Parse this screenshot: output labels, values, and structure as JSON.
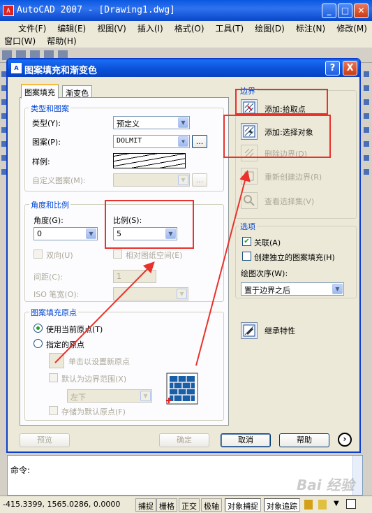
{
  "app": {
    "title": "AutoCAD 2007 - [Drawing1.dwg]",
    "icon_label": "A"
  },
  "menu": {
    "row1": [
      "文件(F)",
      "编辑(E)",
      "视图(V)",
      "插入(I)",
      "格式(O)",
      "工具(T)",
      "绘图(D)",
      "标注(N)",
      "修改(M)"
    ],
    "row2": [
      "窗口(W)",
      "帮助(H)"
    ]
  },
  "dialog": {
    "title": "图案填充和渐变色",
    "help_glyph": "?",
    "close_glyph": "X",
    "tabs": [
      "图案填充",
      "渐变色"
    ],
    "type_pattern": {
      "title": "类型和图案",
      "type_label": "类型(Y):",
      "type_value": "预定义",
      "pattern_label": "图案(P):",
      "pattern_value": "DOLMIT",
      "browse_label": "...",
      "sample_label": "样例:",
      "custom_label": "自定义图案(M):",
      "custom_browse": "..."
    },
    "angle_scale": {
      "title": "角度和比例",
      "angle_label": "角度(G):",
      "angle_value": "0",
      "scale_label": "比例(S):",
      "scale_value": "5",
      "double_label": "双向(U)",
      "relative_label": "相对图纸空间(E)",
      "spacing_label": "间距(C):",
      "spacing_value": "1",
      "iso_label": "ISO 笔宽(O):"
    },
    "origin": {
      "title": "图案填充原点",
      "use_current_label": "使用当前原点(T)",
      "specified_label": "指定的原点",
      "click_set_label": "单击以设置新原点",
      "default_extents_label": "默认为边界范围(X)",
      "position_value": "左下",
      "store_default_label": "存储为默认原点(F)"
    },
    "boundary": {
      "title": "边界",
      "add_pick_label": "添加:拾取点",
      "add_select_label": "添加:选择对象",
      "remove_label": "删除边界(D)",
      "recreate_label": "重新创建边界(R)",
      "view_label": "查看选择集(V)"
    },
    "options": {
      "title": "选项",
      "associative_label": "关联(A)",
      "associative_checked": true,
      "separate_label": "创建独立的图案填充(H)",
      "draw_order_label": "绘图次序(W):",
      "draw_order_value": "置于边界之后"
    },
    "inherit_label": "继承特性",
    "footer": {
      "preview": "预览",
      "ok": "确定",
      "cancel": "取消",
      "help": "帮助",
      "more": "›"
    }
  },
  "command": {
    "prompt": "命令:"
  },
  "statusbar": {
    "coords": "-415.3399, 1565.0286, 0.0000",
    "buttons": [
      "捕捉",
      "栅格",
      "正交",
      "极轴",
      "对象捕捉",
      "对象追踪"
    ]
  },
  "watermark": "Bai 经验",
  "colors": {
    "highlight_box": "#e8322b",
    "title_blue": "#0a4fd6",
    "group_title": "#0046d5"
  }
}
